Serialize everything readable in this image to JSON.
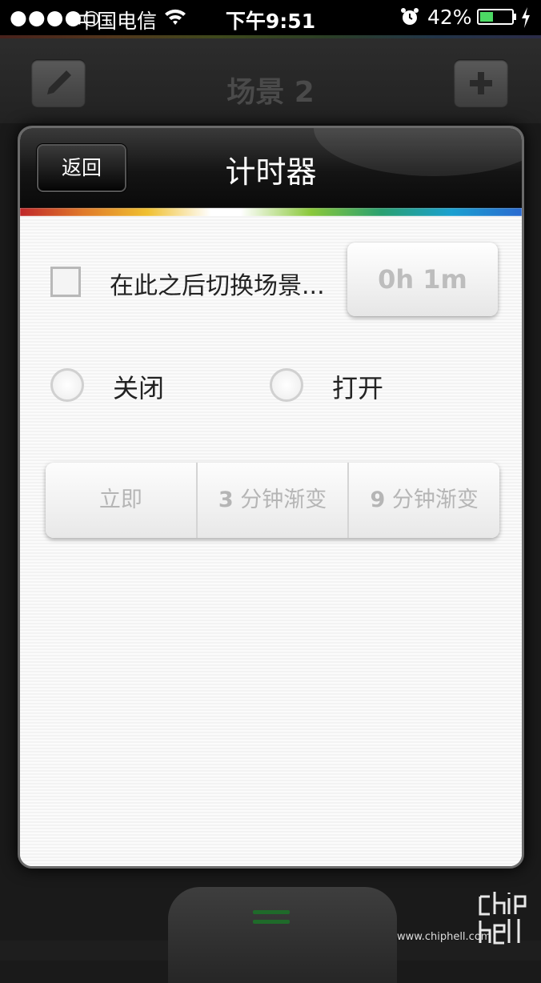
{
  "status_bar": {
    "signal": "●●●●○",
    "carrier": "中国电信",
    "time": "下午9:51",
    "battery_percent": "42%",
    "battery_level": 0.42,
    "icons": [
      "wifi-icon",
      "alarm-icon",
      "battery-icon",
      "charging-bolt-icon"
    ]
  },
  "app_header": {
    "title": "场景 2",
    "left_icon": "pencil-icon",
    "right_icon": "plus-icon"
  },
  "dialog": {
    "back_label": "返回",
    "title": "计时器",
    "checkbox_label": "在此之后切换场景...",
    "checkbox_checked": false,
    "duration_value": "0h 1m",
    "radio_options": [
      {
        "label": "关闭",
        "selected": false
      },
      {
        "label": "打开",
        "selected": false
      }
    ],
    "transition_options": [
      {
        "number": "",
        "text": "立即"
      },
      {
        "number": "3",
        "text": "分钟渐变"
      },
      {
        "number": "9",
        "text": "分钟渐变"
      }
    ]
  },
  "bottom": {
    "menu_icon": "menu-handle-icon"
  },
  "watermark": {
    "url": "www.chiphell.com",
    "logo": "chiphell"
  },
  "colors": {
    "battery": "#4cd964",
    "menu_handle": "#1f6a2a"
  }
}
